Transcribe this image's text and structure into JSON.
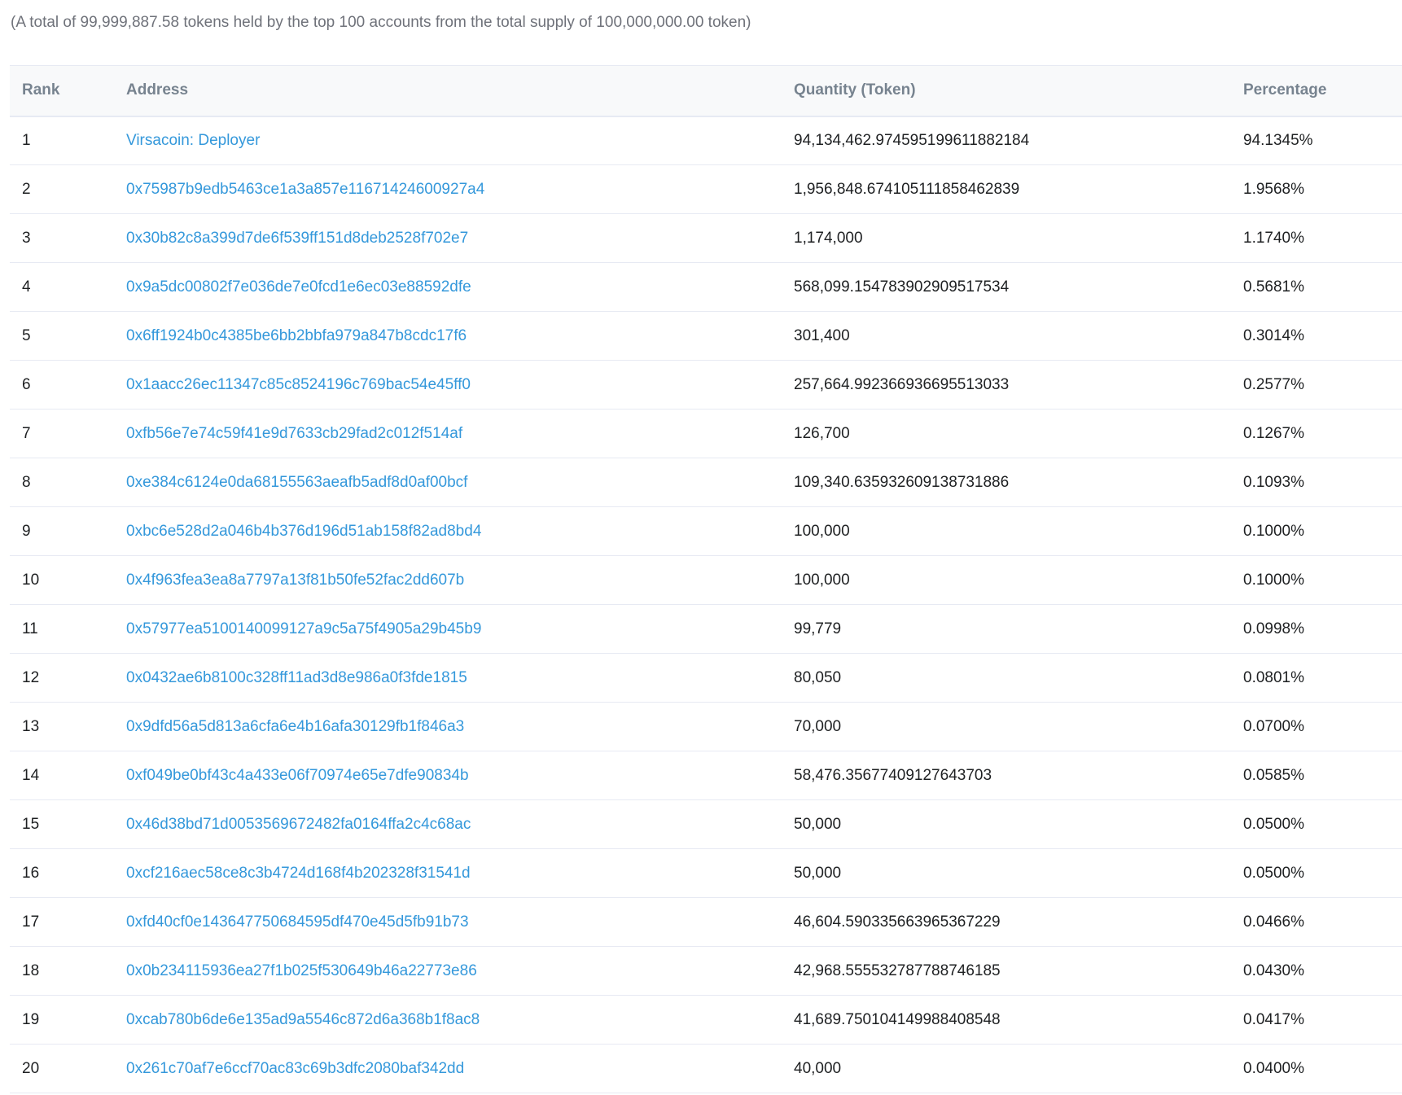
{
  "summary_text": "(A total of 99,999,887.58 tokens held by the top 100 accounts from the total supply of 100,000,000.00 token)",
  "table": {
    "headers": {
      "rank": "Rank",
      "address": "Address",
      "quantity": "Quantity (Token)",
      "percentage": "Percentage"
    },
    "rows": [
      {
        "rank": "1",
        "address": "Virsacoin: Deployer",
        "quantity": "94,134,462.974595199611882184",
        "percentage": "94.1345%"
      },
      {
        "rank": "2",
        "address": "0x75987b9edb5463ce1a3a857e11671424600927a4",
        "quantity": "1,956,848.674105111858462839",
        "percentage": "1.9568%"
      },
      {
        "rank": "3",
        "address": "0x30b82c8a399d7de6f539ff151d8deb2528f702e7",
        "quantity": "1,174,000",
        "percentage": "1.1740%"
      },
      {
        "rank": "4",
        "address": "0x9a5dc00802f7e036de7e0fcd1e6ec03e88592dfe",
        "quantity": "568,099.154783902909517534",
        "percentage": "0.5681%"
      },
      {
        "rank": "5",
        "address": "0x6ff1924b0c4385be6bb2bbfa979a847b8cdc17f6",
        "quantity": "301,400",
        "percentage": "0.3014%"
      },
      {
        "rank": "6",
        "address": "0x1aacc26ec11347c85c8524196c769bac54e45ff0",
        "quantity": "257,664.992366936695513033",
        "percentage": "0.2577%"
      },
      {
        "rank": "7",
        "address": "0xfb56e7e74c59f41e9d7633cb29fad2c012f514af",
        "quantity": "126,700",
        "percentage": "0.1267%"
      },
      {
        "rank": "8",
        "address": "0xe384c6124e0da68155563aeafb5adf8d0af00bcf",
        "quantity": "109,340.635932609138731886",
        "percentage": "0.1093%"
      },
      {
        "rank": "9",
        "address": "0xbc6e528d2a046b4b376d196d51ab158f82ad8bd4",
        "quantity": "100,000",
        "percentage": "0.1000%"
      },
      {
        "rank": "10",
        "address": "0x4f963fea3ea8a7797a13f81b50fe52fac2dd607b",
        "quantity": "100,000",
        "percentage": "0.1000%"
      },
      {
        "rank": "11",
        "address": "0x57977ea5100140099127a9c5a75f4905a29b45b9",
        "quantity": "99,779",
        "percentage": "0.0998%"
      },
      {
        "rank": "12",
        "address": "0x0432ae6b8100c328ff11ad3d8e986a0f3fde1815",
        "quantity": "80,050",
        "percentage": "0.0801%"
      },
      {
        "rank": "13",
        "address": "0x9dfd56a5d813a6cfa6e4b16afa30129fb1f846a3",
        "quantity": "70,000",
        "percentage": "0.0700%"
      },
      {
        "rank": "14",
        "address": "0xf049be0bf43c4a433e06f70974e65e7dfe90834b",
        "quantity": "58,476.35677409127643703",
        "percentage": "0.0585%"
      },
      {
        "rank": "15",
        "address": "0x46d38bd71d0053569672482fa0164ffa2c4c68ac",
        "quantity": "50,000",
        "percentage": "0.0500%"
      },
      {
        "rank": "16",
        "address": "0xcf216aec58ce8c3b4724d168f4b202328f31541d",
        "quantity": "50,000",
        "percentage": "0.0500%"
      },
      {
        "rank": "17",
        "address": "0xfd40cf0e143647750684595df470e45d5fb91b73",
        "quantity": "46,604.590335663965367229",
        "percentage": "0.0466%"
      },
      {
        "rank": "18",
        "address": "0x0b234115936ea27f1b025f530649b46a22773e86",
        "quantity": "42,968.555532787788746185",
        "percentage": "0.0430%"
      },
      {
        "rank": "19",
        "address": "0xcab780b6de6e135ad9a5546c872d6a368b1f8ac8",
        "quantity": "41,689.750104149988408548",
        "percentage": "0.0417%"
      },
      {
        "rank": "20",
        "address": "0x261c70af7e6ccf70ac83c69b3dfc2080baf342dd",
        "quantity": "40,000",
        "percentage": "0.0400%"
      }
    ]
  },
  "colors": {
    "link": "#3498db",
    "text": "#1e2022",
    "muted": "#6f727a",
    "header_text": "#77838f",
    "header_bg": "#f8f9fa",
    "border": "#e7eaf3"
  }
}
